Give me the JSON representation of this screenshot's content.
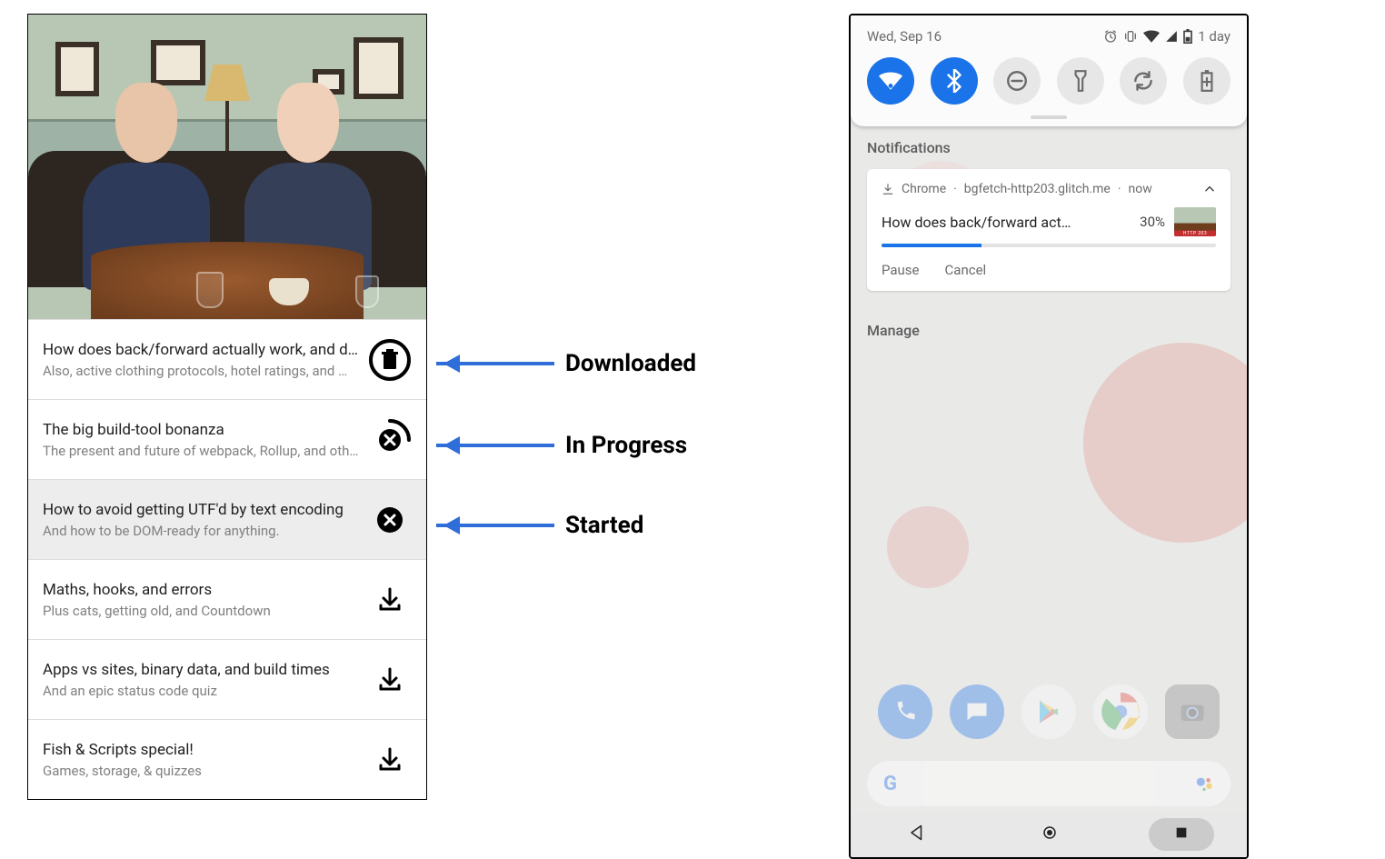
{
  "left_app": {
    "items": [
      {
        "title": "How does back/forward actually work, and does it go wrong?",
        "subtitle": "Also, active clothing protocols, hotel ratings, and more",
        "state": "downloaded",
        "highlight": false
      },
      {
        "title": "The big build-tool bonanza",
        "subtitle": "The present and future of webpack, Rollup, and others",
        "state": "in_progress",
        "highlight": false
      },
      {
        "title": "How to avoid getting UTF'd by text encoding",
        "subtitle": "And how to be DOM-ready for anything.",
        "state": "started",
        "highlight": true
      },
      {
        "title": "Maths, hooks, and errors",
        "subtitle": "Plus cats, getting old, and Countdown",
        "state": "none",
        "highlight": false
      },
      {
        "title": "Apps vs sites, binary data, and build times",
        "subtitle": "And an epic status code quiz",
        "state": "none",
        "highlight": false
      },
      {
        "title": "Fish & Scripts special!",
        "subtitle": "Games, storage, & quizzes",
        "state": "none",
        "highlight": false
      }
    ]
  },
  "annotations": {
    "downloaded": "Downloaded",
    "in_progress": "In Progress",
    "started": "Started"
  },
  "phone": {
    "date": "Wed, Sep 16",
    "battery_label": "1 day",
    "notifications_label": "Notifications",
    "manage_label": "Manage",
    "notification": {
      "app": "Chrome",
      "bullet": "·",
      "source": "bgfetch-http203.glitch.me",
      "time": "now",
      "title": "How does back/forward act…",
      "percent_label": "30%",
      "percent_value": 30,
      "actions": {
        "pause": "Pause",
        "cancel": "Cancel"
      }
    }
  }
}
